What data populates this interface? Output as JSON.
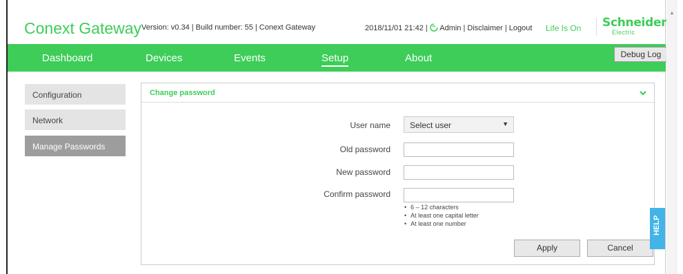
{
  "header": {
    "title": "Conext Gateway",
    "version_text": "Version: v0.34 | Build number: 55 | Conext Gateway",
    "datetime": "2018/11/01 21:42 |",
    "user": "Admin",
    "sep1": "|",
    "disclaimer": "Disclaimer",
    "sep2": "|",
    "logout": "Logout",
    "tagline": "Life Is On",
    "logo_line1": "Schneider",
    "logo_line2": "Electric"
  },
  "nav": {
    "items": [
      "Dashboard",
      "Devices",
      "Events",
      "Setup",
      "About"
    ],
    "active": "Setup",
    "debug_log": "Debug Log"
  },
  "sidebar": {
    "items": [
      "Configuration",
      "Network",
      "Manage Passwords"
    ],
    "active": "Manage Passwords"
  },
  "panel": {
    "title": "Change password",
    "fields": {
      "user_name_label": "User name",
      "user_select_value": "Select user",
      "old_password_label": "Old password",
      "new_password_label": "New password",
      "confirm_password_label": "Confirm password"
    },
    "rules": [
      "6 – 12 characters",
      "At least one capital letter",
      "At least one number"
    ],
    "apply": "Apply",
    "cancel": "Cancel"
  },
  "help": "HELP",
  "colors": {
    "brand_green": "#3dcd58",
    "help_blue": "#42b4e6",
    "sidebar_active": "#9d9d9d"
  }
}
